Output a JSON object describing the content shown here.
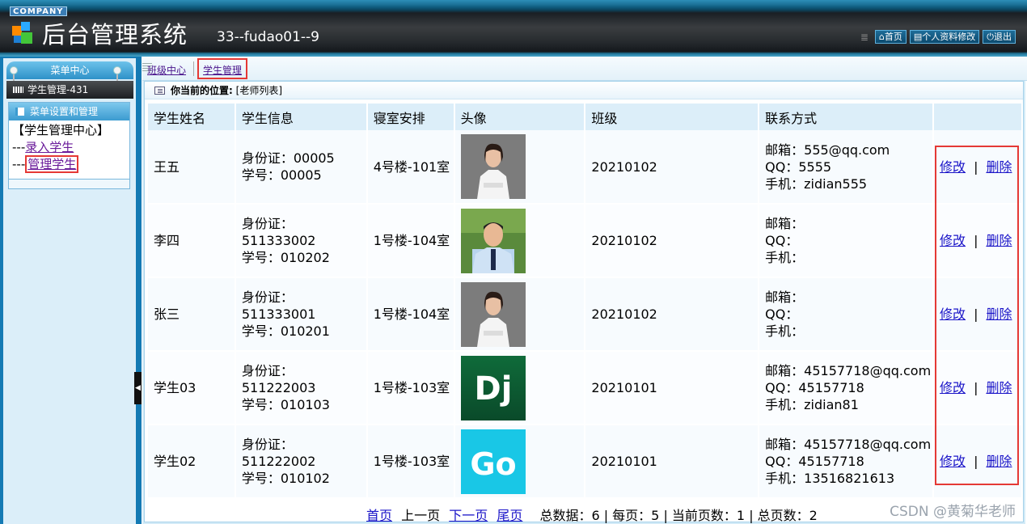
{
  "header": {
    "company": "COMPANY",
    "title": "后台管理系统",
    "user": "33--fudao01--9",
    "buttons": {
      "home": "首页",
      "profile": "个人资料修改",
      "logout": "退出"
    }
  },
  "sidebar": {
    "menu_center": "菜单中心",
    "section": "学生管理-431",
    "panel_title": "菜单设置和管理",
    "root": "【学生管理中心】",
    "items": [
      {
        "prefix": "---",
        "label": "录入学生"
      },
      {
        "prefix": "---",
        "label": "管理学生"
      }
    ]
  },
  "breadcrumb": {
    "items": [
      "班级中心",
      "学生管理"
    ]
  },
  "location": {
    "label": "你当前的位置:",
    "value": "[老师列表]"
  },
  "table": {
    "headers": [
      "学生姓名",
      "学生信息",
      "寝室安排",
      "头像",
      "班级",
      "联系方式",
      ""
    ],
    "rows": [
      {
        "name": "王五",
        "id": "身份证：00005",
        "sno": "学号：00005",
        "dorm": "4号楼-101室",
        "avatar": "photo-woman",
        "class": "20210102",
        "email": "邮箱：555@qq.com",
        "qq": "QQ：5555",
        "phone": "手机：zidian555"
      },
      {
        "name": "李四",
        "id": "身份证：511333002",
        "sno": "学号：010202",
        "dorm": "1号楼-104室",
        "avatar": "photo-man",
        "class": "20210102",
        "email": "邮箱：",
        "qq": "QQ：",
        "phone": "手机："
      },
      {
        "name": "张三",
        "id": "身份证：511333001",
        "sno": "学号：010201",
        "dorm": "1号楼-104室",
        "avatar": "photo-woman",
        "class": "20210102",
        "email": "邮箱：",
        "qq": "QQ：",
        "phone": "手机："
      },
      {
        "name": "学生03",
        "id": "身份证：511222003",
        "sno": "学号：010103",
        "dorm": "1号楼-103室",
        "avatar": "dj-logo",
        "avatar_text": "Dj",
        "class": "20210101",
        "email": "邮箱：45157718@qq.com",
        "qq": "QQ：45157718",
        "phone": "手机：zidian81"
      },
      {
        "name": "学生02",
        "id": "身份证：511222002",
        "sno": "学号：010102",
        "dorm": "1号楼-103室",
        "avatar": "go-logo",
        "avatar_text": "Go",
        "class": "20210101",
        "email": "邮箱：45157718@qq.com",
        "qq": "QQ：45157718",
        "phone": "手机：13516821613"
      }
    ],
    "edit_label": "修改",
    "delete_label": "删除",
    "sep": "|"
  },
  "pager": {
    "first": "首页",
    "prev": "上一页",
    "next": "下一页",
    "last": "尾页",
    "summary": "总数据：6 | 每页：5 | 当前页数：1 | 总页数：2"
  },
  "watermark": "CSDN @黄菊华老师"
}
